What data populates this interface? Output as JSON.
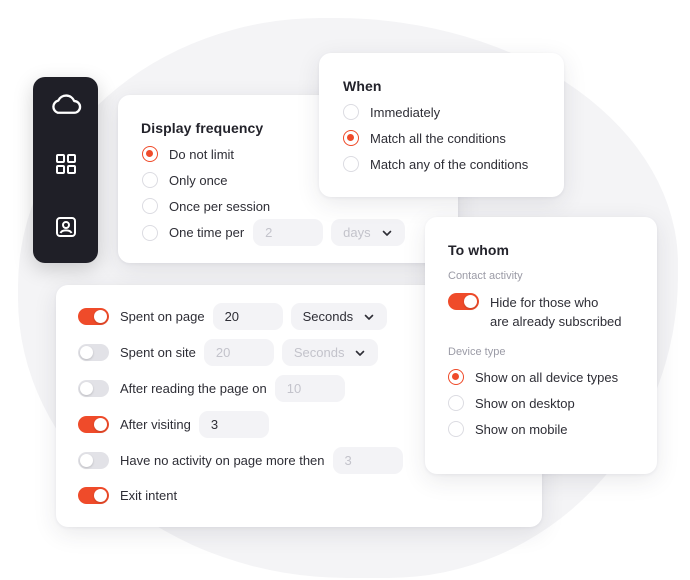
{
  "display_frequency": {
    "title": "Display frequency",
    "options": [
      "Do not limit",
      "Only once",
      "Once per session",
      "One time per"
    ],
    "selected": 0,
    "count_placeholder": "2",
    "unit_placeholder": "days"
  },
  "when": {
    "title": "When",
    "options": [
      "Immediately",
      "Match all the conditions",
      "Match any of the conditions"
    ],
    "selected": 1
  },
  "to_whom": {
    "title": "To whom",
    "contact_activity_label": "Contact activity",
    "hide_line1": "Hide for those who",
    "hide_line2": "are already subscribed",
    "hide_enabled": true,
    "device_type_label": "Device type",
    "devices": [
      "Show on all device types",
      "Show on desktop",
      "Show on mobile"
    ],
    "selected_device": 0
  },
  "triggers": {
    "spent_on_page": {
      "label": "Spent on page",
      "enabled": true,
      "value": "20",
      "unit": "Seconds"
    },
    "spent_on_site": {
      "label": "Spent on site",
      "enabled": false,
      "placeholder": "20",
      "unit": "Seconds"
    },
    "after_reading": {
      "label": "After reading the page on",
      "enabled": false,
      "placeholder": "10"
    },
    "after_visiting": {
      "label": "After visiting",
      "enabled": true,
      "value": "3"
    },
    "no_activity": {
      "label": "Have no activity on page more then",
      "enabled": false,
      "placeholder": "3"
    },
    "exit_intent": {
      "label": "Exit intent",
      "enabled": true
    }
  },
  "sidebar": {
    "icons": [
      "cloud-icon",
      "grid-icon",
      "contact-icon"
    ]
  },
  "colors": {
    "accent": "#ef4b2a",
    "sidebar": "#1f1f27",
    "backdrop": "#f4f4f6"
  }
}
